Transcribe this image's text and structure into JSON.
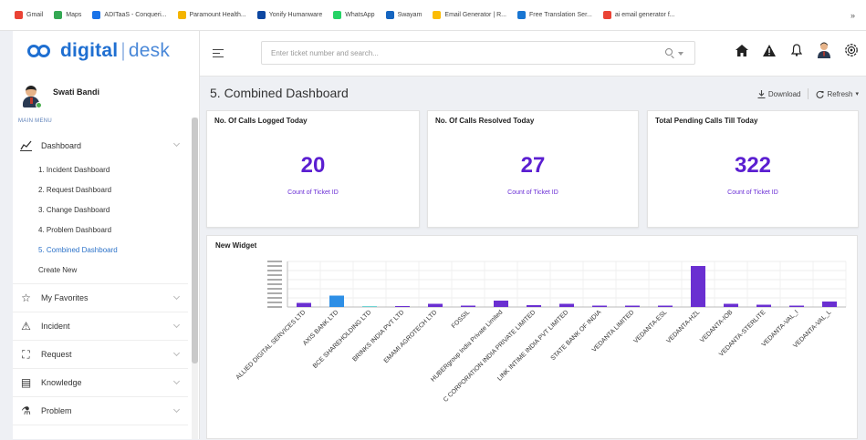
{
  "bookmarks": [
    {
      "label": "Gmail",
      "color": "#ea4335"
    },
    {
      "label": "Maps",
      "color": "#34a853"
    },
    {
      "label": "ADITaaS - Conqueri...",
      "color": "#1a73e8"
    },
    {
      "label": "Paramount Health...",
      "color": "#f4b400"
    },
    {
      "label": "Yonify Humanware",
      "color": "#0d47a1"
    },
    {
      "label": "WhatsApp",
      "color": "#25d366"
    },
    {
      "label": "Swayam",
      "color": "#1565c0"
    },
    {
      "label": "Email Generator | R...",
      "color": "#fbbc05"
    },
    {
      "label": "Free Translation Ser...",
      "color": "#1976d2"
    },
    {
      "label": "ai email generator f...",
      "color": "#ea4335"
    }
  ],
  "bookmarks_more": "»",
  "brand": {
    "name": "digital",
    "suffix": "desk"
  },
  "user": {
    "name": "Swati Bandi"
  },
  "sidebar": {
    "section_label": "MAIN MENU",
    "dashboard": {
      "label": "Dashboard",
      "icon": "chart-icon"
    },
    "sub_items": [
      "1. Incident Dashboard",
      "2. Request Dashboard",
      "3. Change Dashboard",
      "4. Problem Dashboard",
      "5. Combined Dashboard",
      "Create New"
    ],
    "items": [
      {
        "label": "My Favorites",
        "icon": "star-icon",
        "glyph": "☆"
      },
      {
        "label": "Incident",
        "icon": "warning-icon",
        "glyph": "⚠"
      },
      {
        "label": "Request",
        "icon": "request-icon",
        "glyph": "⛶"
      },
      {
        "label": "Knowledge",
        "icon": "knowledge-icon",
        "glyph": "▤"
      },
      {
        "label": "Problem",
        "icon": "problem-icon",
        "glyph": "⚗"
      }
    ]
  },
  "search": {
    "placeholder": "Enter ticket number and search..."
  },
  "page": {
    "title": "5. Combined Dashboard",
    "download_label": "Download",
    "refresh_label": "Refresh"
  },
  "cards": [
    {
      "title": "No. Of Calls Logged Today",
      "value": "20",
      "caption": "Count of Ticket ID"
    },
    {
      "title": "No. Of Calls Resolved Today",
      "value": "27",
      "caption": "Count of Ticket ID"
    },
    {
      "title": "Total Pending Calls Till Today",
      "value": "322",
      "caption": "Count of Ticket ID"
    }
  ],
  "colors": {
    "accent": "#5b1fd1",
    "brand": "#1f6fd1",
    "bar": "#6a2fd1",
    "bar_alt": "#2e8fe6",
    "bar_teal": "#6fd3d3"
  },
  "chart_data": {
    "type": "bar",
    "title": "New Widget",
    "categories": [
      "ALLIED DIGITAL SERVICES LTD",
      "AXIS BANK LTD",
      "BCE SHAREHOLDING LTD",
      "BRINKS INDIA PVT LTD",
      "EMAMI AGROTECH LTD",
      "FOSSIL",
      "HUBERgroup India Private Limited",
      "C CORPORATION INDIA PRIVATE LIMITED",
      "LINK INTIME INDIA PVT LIMITED",
      "STATE BANK OF INDIA",
      "VEDANTA LIMITED",
      "VEDANTA-ESL",
      "VEDANTA-HZL",
      "VEDANTA-IOB",
      "VEDANTA-STERLITE",
      "VEDANTA-VAL_I",
      "VEDANTA-VAL_L"
    ],
    "values": [
      9,
      25,
      2,
      2,
      7,
      3,
      14,
      4,
      7,
      3,
      3,
      3,
      90,
      7,
      5,
      3,
      12
    ],
    "bar_colors": [
      "#6a2fd1",
      "#2e8fe6",
      "#6fd3d3",
      "#6a2fd1",
      "#6a2fd1",
      "#6a2fd1",
      "#6a2fd1",
      "#6a2fd1",
      "#6a2fd1",
      "#6a2fd1",
      "#6a2fd1",
      "#6a2fd1",
      "#6a2fd1",
      "#6a2fd1",
      "#6a2fd1",
      "#6a2fd1",
      "#6a2fd1"
    ],
    "ylim": [
      0,
      100
    ],
    "grid": true
  }
}
